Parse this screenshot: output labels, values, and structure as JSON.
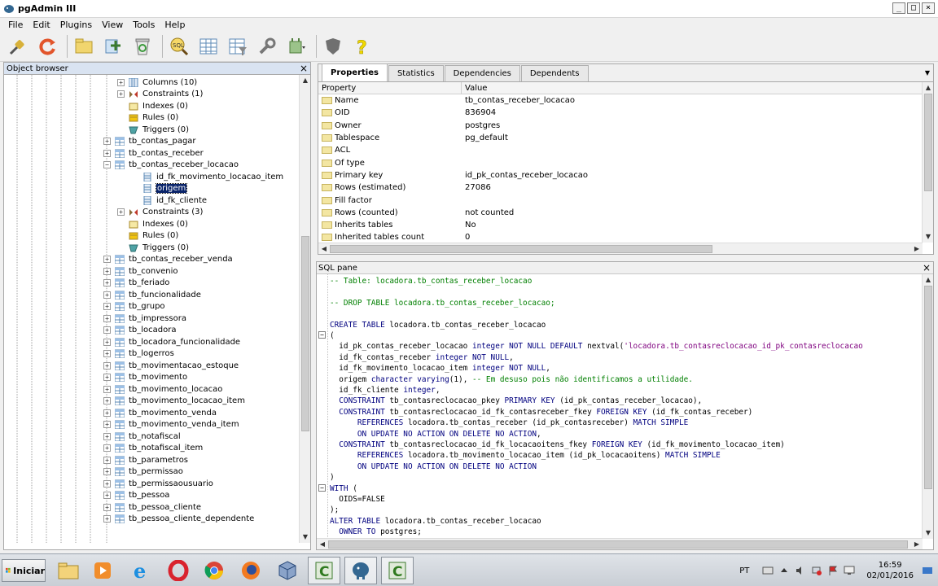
{
  "window": {
    "title": "pgAdmin III"
  },
  "menubar": [
    "File",
    "Edit",
    "Plugins",
    "View",
    "Tools",
    "Help"
  ],
  "object_browser": {
    "title": "Object browser",
    "items": [
      {
        "label": "Columns (10)",
        "indent": 2,
        "expander": "+",
        "icon": "columns"
      },
      {
        "label": "Constraints (1)",
        "indent": 2,
        "expander": "+",
        "icon": "constraint"
      },
      {
        "label": "Indexes (0)",
        "indent": 2,
        "expander": "",
        "icon": "index"
      },
      {
        "label": "Rules (0)",
        "indent": 2,
        "expander": "",
        "icon": "rule"
      },
      {
        "label": "Triggers (0)",
        "indent": 2,
        "expander": "",
        "icon": "trigger"
      },
      {
        "label": "tb_contas_pagar",
        "indent": 1,
        "expander": "+",
        "icon": "table"
      },
      {
        "label": "tb_contas_receber",
        "indent": 1,
        "expander": "+",
        "icon": "table"
      },
      {
        "label": "tb_contas_receber_locacao",
        "indent": 1,
        "expander": "-",
        "icon": "table"
      },
      {
        "label": "id_fk_movimento_locacao_item",
        "indent": 3,
        "expander": "",
        "icon": "column"
      },
      {
        "label": "origem",
        "indent": 3,
        "expander": "",
        "icon": "column",
        "selected": true
      },
      {
        "label": "id_fk_cliente",
        "indent": 3,
        "expander": "",
        "icon": "column"
      },
      {
        "label": "Constraints (3)",
        "indent": 2,
        "expander": "+",
        "icon": "constraint"
      },
      {
        "label": "Indexes (0)",
        "indent": 2,
        "expander": "",
        "icon": "index"
      },
      {
        "label": "Rules (0)",
        "indent": 2,
        "expander": "",
        "icon": "rule"
      },
      {
        "label": "Triggers (0)",
        "indent": 2,
        "expander": "",
        "icon": "trigger"
      },
      {
        "label": "tb_contas_receber_venda",
        "indent": 1,
        "expander": "+",
        "icon": "table"
      },
      {
        "label": "tb_convenio",
        "indent": 1,
        "expander": "+",
        "icon": "table"
      },
      {
        "label": "tb_feriado",
        "indent": 1,
        "expander": "+",
        "icon": "table"
      },
      {
        "label": "tb_funcionalidade",
        "indent": 1,
        "expander": "+",
        "icon": "table"
      },
      {
        "label": "tb_grupo",
        "indent": 1,
        "expander": "+",
        "icon": "table"
      },
      {
        "label": "tb_impressora",
        "indent": 1,
        "expander": "+",
        "icon": "table"
      },
      {
        "label": "tb_locadora",
        "indent": 1,
        "expander": "+",
        "icon": "table"
      },
      {
        "label": "tb_locadora_funcionalidade",
        "indent": 1,
        "expander": "+",
        "icon": "table"
      },
      {
        "label": "tb_logerros",
        "indent": 1,
        "expander": "+",
        "icon": "table"
      },
      {
        "label": "tb_movimentacao_estoque",
        "indent": 1,
        "expander": "+",
        "icon": "table"
      },
      {
        "label": "tb_movimento",
        "indent": 1,
        "expander": "+",
        "icon": "table"
      },
      {
        "label": "tb_movimento_locacao",
        "indent": 1,
        "expander": "+",
        "icon": "table"
      },
      {
        "label": "tb_movimento_locacao_item",
        "indent": 1,
        "expander": "+",
        "icon": "table"
      },
      {
        "label": "tb_movimento_venda",
        "indent": 1,
        "expander": "+",
        "icon": "table"
      },
      {
        "label": "tb_movimento_venda_item",
        "indent": 1,
        "expander": "+",
        "icon": "table"
      },
      {
        "label": "tb_notafiscal",
        "indent": 1,
        "expander": "+",
        "icon": "table"
      },
      {
        "label": "tb_notafiscal_item",
        "indent": 1,
        "expander": "+",
        "icon": "table"
      },
      {
        "label": "tb_parametros",
        "indent": 1,
        "expander": "+",
        "icon": "table"
      },
      {
        "label": "tb_permissao",
        "indent": 1,
        "expander": "+",
        "icon": "table"
      },
      {
        "label": "tb_permissaousuario",
        "indent": 1,
        "expander": "+",
        "icon": "table"
      },
      {
        "label": "tb_pessoa",
        "indent": 1,
        "expander": "+",
        "icon": "table"
      },
      {
        "label": "tb_pessoa_cliente",
        "indent": 1,
        "expander": "+",
        "icon": "table"
      },
      {
        "label": "tb_pessoa_cliente_dependente",
        "indent": 1,
        "expander": "+",
        "icon": "table"
      }
    ]
  },
  "properties": {
    "tabs": [
      "Properties",
      "Statistics",
      "Dependencies",
      "Dependents"
    ],
    "active_tab": "Properties",
    "columns": [
      "Property",
      "Value"
    ],
    "rows": [
      {
        "name": "Name",
        "value": "tb_contas_receber_locacao"
      },
      {
        "name": "OID",
        "value": "836904"
      },
      {
        "name": "Owner",
        "value": "postgres"
      },
      {
        "name": "Tablespace",
        "value": "pg_default"
      },
      {
        "name": "ACL",
        "value": ""
      },
      {
        "name": "Of type",
        "value": ""
      },
      {
        "name": "Primary key",
        "value": "id_pk_contas_receber_locacao"
      },
      {
        "name": "Rows (estimated)",
        "value": "27086"
      },
      {
        "name": "Fill factor",
        "value": ""
      },
      {
        "name": "Rows (counted)",
        "value": "not counted"
      },
      {
        "name": "Inherits tables",
        "value": "No"
      },
      {
        "name": "Inherited tables count",
        "value": "0"
      }
    ]
  },
  "sql_pane": {
    "title": "SQL pane",
    "lines": [
      [
        [
          "cm",
          "-- Table: locadora.tb_contas_receber_locacao"
        ]
      ],
      [],
      [
        [
          "cm",
          "-- DROP TABLE locadora.tb_contas_receber_locacao;"
        ]
      ],
      [],
      [
        [
          "kw",
          "CREATE TABLE"
        ],
        [
          "pl",
          " locadora.tb_contas_receber_locacao"
        ]
      ],
      [
        [
          "pl",
          "("
        ]
      ],
      [
        [
          "pl",
          "  id_pk_contas_receber_locacao "
        ],
        [
          "kw",
          "integer NOT NULL DEFAULT"
        ],
        [
          "pl",
          " nextval("
        ],
        [
          "st",
          "'locadora.tb_contasreclocacao_id_pk_contasreclocacao"
        ]
      ],
      [
        [
          "pl",
          "  id_fk_contas_receber "
        ],
        [
          "kw",
          "integer NOT NULL"
        ],
        [
          "pl",
          ","
        ]
      ],
      [
        [
          "pl",
          "  id_fk_movimento_locacao_item "
        ],
        [
          "kw",
          "integer NOT NULL"
        ],
        [
          "pl",
          ","
        ]
      ],
      [
        [
          "pl",
          "  origem "
        ],
        [
          "kw",
          "character varying"
        ],
        [
          "pl",
          "(1), "
        ],
        [
          "cm",
          "-- Em desuso pois não identificamos a utilidade."
        ]
      ],
      [
        [
          "pl",
          "  id_fk_cliente "
        ],
        [
          "kw",
          "integer"
        ],
        [
          "pl",
          ","
        ]
      ],
      [
        [
          "kw",
          "  CONSTRAINT"
        ],
        [
          "pl",
          " tb_contasreclocacao_pkey "
        ],
        [
          "kw",
          "PRIMARY KEY"
        ],
        [
          "pl",
          " (id_pk_contas_receber_locacao),"
        ]
      ],
      [
        [
          "kw",
          "  CONSTRAINT"
        ],
        [
          "pl",
          " tb_contasreclocacao_id_fk_contasreceber_fkey "
        ],
        [
          "kw",
          "FOREIGN KEY"
        ],
        [
          "pl",
          " (id_fk_contas_receber)"
        ]
      ],
      [
        [
          "kw",
          "      REFERENCES"
        ],
        [
          "pl",
          " locadora.tb_contas_receber (id_pk_contasreceber) "
        ],
        [
          "kw",
          "MATCH SIMPLE"
        ]
      ],
      [
        [
          "kw",
          "      ON UPDATE NO ACTION ON DELETE NO ACTION"
        ],
        [
          "pl",
          ","
        ]
      ],
      [
        [
          "kw",
          "  CONSTRAINT"
        ],
        [
          "pl",
          " tb_contasreclocacao_id_fk_locacaoitens_fkey "
        ],
        [
          "kw",
          "FOREIGN KEY"
        ],
        [
          "pl",
          " (id_fk_movimento_locacao_item)"
        ]
      ],
      [
        [
          "kw",
          "      REFERENCES"
        ],
        [
          "pl",
          " locadora.tb_movimento_locacao_item (id_pk_locacaoitens) "
        ],
        [
          "kw",
          "MATCH SIMPLE"
        ]
      ],
      [
        [
          "kw",
          "      ON UPDATE NO ACTION ON DELETE NO ACTION"
        ]
      ],
      [
        [
          "pl",
          ")"
        ]
      ],
      [
        [
          "kw",
          "WITH"
        ],
        [
          "pl",
          " ("
        ]
      ],
      [
        [
          "pl",
          "  OIDS=FALSE"
        ]
      ],
      [
        [
          "pl",
          ");"
        ]
      ],
      [
        [
          "kw",
          "ALTER TABLE"
        ],
        [
          "pl",
          " locadora.tb_contas_receber_locacao"
        ]
      ],
      [
        [
          "kw",
          "  OWNER TO"
        ],
        [
          "pl",
          " postgres;"
        ]
      ]
    ]
  },
  "taskbar": {
    "start_label": "Iniciar",
    "language": "PT",
    "time": "16:59",
    "date": "02/01/2016"
  },
  "colors": {
    "selection": "#0a246a",
    "sql_keyword": "#00007f",
    "sql_comment": "#007f00",
    "sql_string": "#7f007f"
  }
}
